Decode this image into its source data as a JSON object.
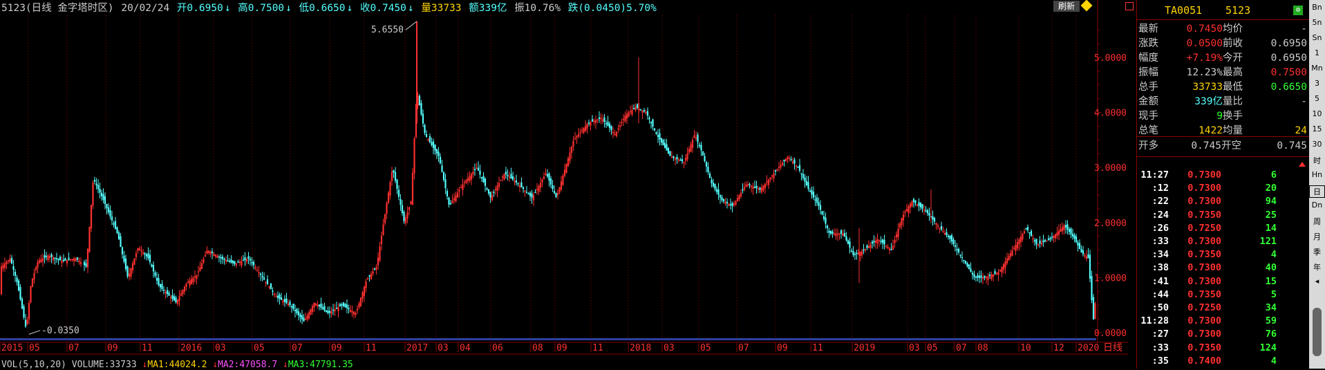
{
  "header": {
    "code_period": "5123(日线 金字塔时区)",
    "date": "20/02/24",
    "open": "开0.6950",
    "high": "高0.7500",
    "low": "低0.6650",
    "close": "收0.7450",
    "volume": "量33733",
    "amount": "额339亿",
    "amplitude": "振10.76%",
    "change": "跌(0.0450)5.70%",
    "refresh_label": "刷新"
  },
  "chart": {
    "price_axis_ticks": [
      "5.0000",
      "4.0000",
      "3.0000",
      "2.0000",
      "1.0000",
      "0.0000"
    ],
    "high_marker": "5.6550",
    "low_marker": "-0.0350",
    "x_labels": [
      "2015",
      "05",
      "07",
      "09",
      "11",
      "2016",
      "03",
      "05",
      "07",
      "09",
      "11",
      "2017",
      "03",
      "04",
      "06",
      "08",
      "09",
      "11",
      "2018",
      "03",
      "05",
      "07",
      "09",
      "11",
      "2019",
      "03",
      "05",
      "07",
      "08",
      "10",
      "12",
      "2020"
    ],
    "period_label": "日线",
    "up_color": "#ff3030",
    "down_color": "#54ffff"
  },
  "vol_line": {
    "params": "VOL(5,10,20) VOLUME:33733",
    "ma1": "MA1:44024.2",
    "ma2": "MA2:47058.7",
    "ma3": "MA3:47791.35"
  },
  "panel": {
    "code": "TA0051",
    "name": "5123",
    "quote": [
      {
        "l1": "最新",
        "v1": "0.7450",
        "c1": "#ff3030",
        "l2": "均价",
        "v2": "-",
        "c2": "#ccc"
      },
      {
        "l1": "涨跌",
        "v1": "0.0500",
        "c1": "#ff3030",
        "l2": "前收",
        "v2": "0.6950",
        "c2": "#ccc"
      },
      {
        "l1": "幅度",
        "v1": "+7.19%",
        "c1": "#ff3030",
        "l2": "今开",
        "v2": "0.6950",
        "c2": "#ccc"
      },
      {
        "l1": "振幅",
        "v1": "12.23%",
        "c1": "#ccc",
        "l2": "最高",
        "v2": "0.7500",
        "c2": "#ff3030"
      },
      {
        "l1": "总手",
        "v1": "33733",
        "c1": "#ffd400",
        "l2": "最低",
        "v2": "0.6650",
        "c2": "#33ff33"
      },
      {
        "l1": "金额",
        "v1": "339亿",
        "c1": "#54ffff",
        "l2": "量比",
        "v2": "-",
        "c2": "#ccc"
      },
      {
        "l1": "现手",
        "v1": "9",
        "c1": "#33ff33",
        "l2": "换手",
        "v2": "",
        "c2": "#ccc"
      },
      {
        "l1": "总笔",
        "v1": "1422",
        "c1": "#ffd400",
        "l2": "均量",
        "v2": "24",
        "c2": "#ffd400"
      }
    ],
    "open_long_label": "开多",
    "open_long_value": "0.745",
    "open_short_label": "开空",
    "open_short_value": "0.745",
    "ticks": [
      {
        "t": "11:27",
        "p": "0.7300",
        "v": "6"
      },
      {
        "t": ":12",
        "p": "0.7300",
        "v": "20"
      },
      {
        "t": ":22",
        "p": "0.7300",
        "v": "94"
      },
      {
        "t": ":24",
        "p": "0.7350",
        "v": "25"
      },
      {
        "t": ":26",
        "p": "0.7250",
        "v": "14"
      },
      {
        "t": ":33",
        "p": "0.7300",
        "v": "121"
      },
      {
        "t": ":34",
        "p": "0.7350",
        "v": "4"
      },
      {
        "t": ":38",
        "p": "0.7300",
        "v": "40"
      },
      {
        "t": ":41",
        "p": "0.7300",
        "v": "15"
      },
      {
        "t": ":44",
        "p": "0.7350",
        "v": "5"
      },
      {
        "t": ":50",
        "p": "0.7250",
        "v": "34"
      },
      {
        "t": "11:28",
        "p": "0.7300",
        "v": "59"
      },
      {
        "t": ":27",
        "p": "0.7300",
        "v": "76"
      },
      {
        "t": ":33",
        "p": "0.7350",
        "v": "124"
      },
      {
        "t": ":35",
        "p": "0.7400",
        "v": "4"
      }
    ]
  },
  "toolbar": [
    "Bn",
    "5n",
    "Sn",
    "1",
    "Mn",
    "3",
    "5",
    "10",
    "15",
    "30",
    "时",
    "Hn",
    "日",
    "Dn",
    "周",
    "月",
    "季",
    "年"
  ]
}
